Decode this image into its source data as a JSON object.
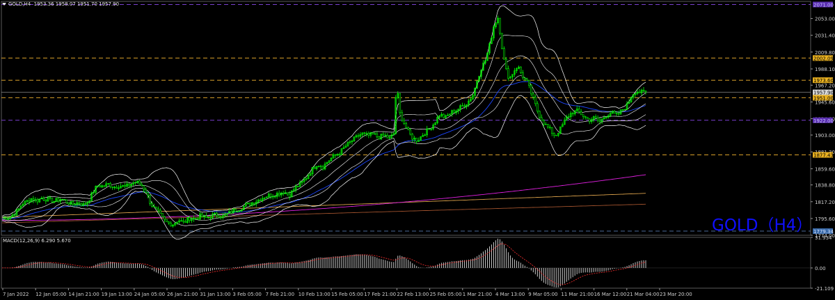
{
  "header": {
    "symbol": "GOLD,H4",
    "ohlc": "1953.36 1958.07 1951.70 1957.90"
  },
  "watermark": "GOLD（H4）",
  "macd": {
    "label": "MACD(12,26,9) 6.290 5.670"
  },
  "colors": {
    "background": "#000000",
    "grid": "#1e1e1e",
    "candle": "#00ff00",
    "bollinger": "#ffffff",
    "ma_blue": "#1c46ff",
    "ma_magenta": "#e020e0",
    "ma_orange": "#d9a04a",
    "ma_brown": "#a0522d",
    "level_orange": "#d9a02a",
    "level_purple": "#7a3fd0",
    "level_blue": "#4a6a9a",
    "macd_hist": "#c8c8c8",
    "macd_signal": "#ff3030"
  },
  "chart_data": [
    {
      "type": "candlestick",
      "symbol": "GOLD",
      "timeframe": "H4",
      "ylim": [
        1774,
        2075
      ],
      "y_ticks": [
        "2053.00",
        "2031.40",
        "2009.80",
        "1988.10",
        "1967.20",
        "1945.60",
        "1924.00",
        "1903.00",
        "1881.30",
        "1859.60",
        "1838.80",
        "1817.20",
        "1795.60",
        "1774.00"
      ],
      "x_ticks": [
        "7 Jan 2022",
        "12 Jan 05:00",
        "14 Jan 21:00",
        "19 Jan 13:00",
        "24 Jan 05:00",
        "26 Jan 21:00",
        "31 Jan 13:00",
        "3 Feb 05:00",
        "7 Feb 21:00",
        "10 Feb 13:00",
        "15 Feb 05:00",
        "17 Feb 21:00",
        "22 Feb 13:00",
        "25 Feb 05:00",
        "1 Mar 21:00",
        "4 Mar 13:00",
        "9 Mar 05:00",
        "11 Mar 21:00",
        "16 Mar 12:00",
        "21 Mar 04:00",
        "23 Mar 20:00"
      ],
      "price_levels": [
        {
          "label": "2071.00",
          "price": 2071.0,
          "color": "purple",
          "style": "dashed"
        },
        {
          "label": "2002.09",
          "price": 2002.09,
          "color": "orange",
          "style": "dashed"
        },
        {
          "label": "1973.60",
          "price": 1973.6,
          "color": "orange",
          "style": "dashed"
        },
        {
          "label": "1957.90",
          "price": 1957.9,
          "color": "white",
          "style": "current"
        },
        {
          "label": "1951.00",
          "price": 1951.0,
          "color": "orange",
          "style": "dashed"
        },
        {
          "label": "1922.00",
          "price": 1922.0,
          "color": "purple",
          "style": "dashed"
        },
        {
          "label": "1877.43",
          "price": 1877.43,
          "color": "orange",
          "style": "dashed"
        },
        {
          "label": "1779.34",
          "price": 1779.34,
          "color": "blue",
          "style": "dashed"
        }
      ],
      "close_path": [
        [
          0,
          1795
        ],
        [
          15,
          1798
        ],
        [
          25,
          1805
        ],
        [
          32,
          1815
        ],
        [
          40,
          1818
        ],
        [
          46,
          1822
        ],
        [
          52,
          1818
        ],
        [
          60,
          1822
        ],
        [
          68,
          1820
        ],
        [
          78,
          1818
        ],
        [
          88,
          1821
        ],
        [
          96,
          1817
        ],
        [
          104,
          1814
        ],
        [
          112,
          1816
        ],
        [
          120,
          1813
        ],
        [
          127,
          1818
        ],
        [
          134,
          1830
        ],
        [
          140,
          1838
        ],
        [
          148,
          1837
        ],
        [
          156,
          1840
        ],
        [
          164,
          1836
        ],
        [
          172,
          1838
        ],
        [
          180,
          1836
        ],
        [
          188,
          1840
        ],
        [
          196,
          1843
        ],
        [
          204,
          1838
        ],
        [
          210,
          1830
        ],
        [
          216,
          1816
        ],
        [
          222,
          1808
        ],
        [
          228,
          1803
        ],
        [
          234,
          1795
        ],
        [
          240,
          1790
        ],
        [
          248,
          1788
        ],
        [
          256,
          1794
        ],
        [
          264,
          1790
        ],
        [
          272,
          1796
        ],
        [
          280,
          1795
        ],
        [
          288,
          1799
        ],
        [
          296,
          1796
        ],
        [
          304,
          1799
        ],
        [
          312,
          1801
        ],
        [
          320,
          1798
        ],
        [
          328,
          1802
        ],
        [
          336,
          1806
        ],
        [
          344,
          1808
        ],
        [
          352,
          1812
        ],
        [
          360,
          1815
        ],
        [
          368,
          1818
        ],
        [
          376,
          1822
        ],
        [
          384,
          1825
        ],
        [
          392,
          1826
        ],
        [
          400,
          1828
        ],
        [
          408,
          1830
        ],
        [
          416,
          1826
        ],
        [
          424,
          1835
        ],
        [
          432,
          1840
        ],
        [
          440,
          1848
        ],
        [
          448,
          1858
        ],
        [
          456,
          1866
        ],
        [
          464,
          1862
        ],
        [
          472,
          1870
        ],
        [
          480,
          1876
        ],
        [
          488,
          1880
        ],
        [
          496,
          1888
        ],
        [
          504,
          1894
        ],
        [
          512,
          1900
        ],
        [
          520,
          1905
        ],
        [
          528,
          1902
        ],
        [
          536,
          1904
        ],
        [
          544,
          1900
        ],
        [
          552,
          1903
        ],
        [
          560,
          1898
        ],
        [
          566,
          1905
        ],
        [
          570,
          1972
        ],
        [
          574,
          1932
        ],
        [
          580,
          1920
        ],
        [
          586,
          1908
        ],
        [
          592,
          1900
        ],
        [
          600,
          1896
        ],
        [
          608,
          1904
        ],
        [
          616,
          1910
        ],
        [
          624,
          1918
        ],
        [
          632,
          1930
        ],
        [
          640,
          1925
        ],
        [
          648,
          1932
        ],
        [
          656,
          1935
        ],
        [
          664,
          1940
        ],
        [
          672,
          1945
        ],
        [
          680,
          1955
        ],
        [
          686,
          1975
        ],
        [
          692,
          1990
        ],
        [
          698,
          2000
        ],
        [
          704,
          2020
        ],
        [
          710,
          2045
        ],
        [
          716,
          2055
        ],
        [
          720,
          2025
        ],
        [
          726,
          1990
        ],
        [
          732,
          1975
        ],
        [
          738,
          1985
        ],
        [
          744,
          1992
        ],
        [
          750,
          1980
        ],
        [
          758,
          1970
        ],
        [
          766,
          1950
        ],
        [
          774,
          1930
        ],
        [
          782,
          1918
        ],
        [
          790,
          1910
        ],
        [
          798,
          1902
        ],
        [
          806,
          1912
        ],
        [
          814,
          1925
        ],
        [
          822,
          1932
        ],
        [
          830,
          1934
        ],
        [
          838,
          1928
        ],
        [
          846,
          1922
        ],
        [
          854,
          1925
        ],
        [
          862,
          1920
        ],
        [
          870,
          1928
        ],
        [
          878,
          1932
        ],
        [
          886,
          1928
        ],
        [
          894,
          1935
        ],
        [
          902,
          1942
        ],
        [
          908,
          1955
        ],
        [
          914,
          1960
        ],
        [
          920,
          1958
        ],
        [
          928,
          1957.9
        ]
      ]
    },
    {
      "type": "bar",
      "indicator": "MACD(12,26,9)",
      "main": 6.29,
      "signal": 5.67,
      "ylim": [
        -21.109,
        31.934
      ],
      "y_ticks": [
        "31.934",
        "0.00",
        "-21.109"
      ]
    }
  ]
}
